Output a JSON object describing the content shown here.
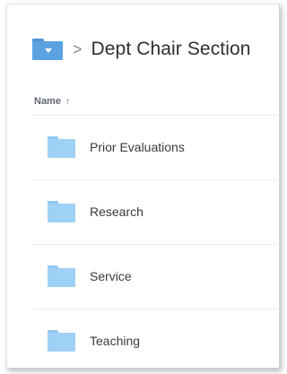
{
  "breadcrumb": {
    "root_icon": "folder-icon",
    "separator": ">",
    "current": "Dept Chair Section"
  },
  "list": {
    "column_header": "Name",
    "sort_indicator": "↑",
    "items": [
      {
        "label": "Prior Evaluations",
        "icon": "folder-icon"
      },
      {
        "label": "Research",
        "icon": "folder-icon"
      },
      {
        "label": "Service",
        "icon": "folder-icon"
      },
      {
        "label": "Teaching",
        "icon": "folder-icon"
      }
    ]
  },
  "colors": {
    "breadcrumb_folder": "#5aa2e2",
    "folder": "#9fd0f6",
    "text": "#3a3a3a",
    "header_text": "#5f6670"
  }
}
